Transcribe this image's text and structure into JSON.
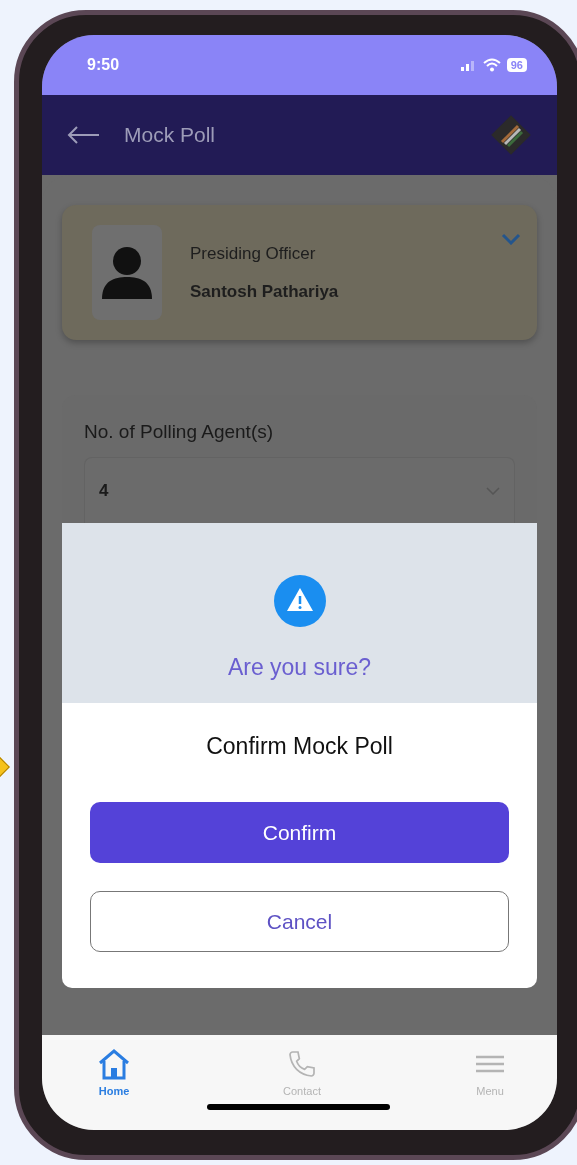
{
  "status_bar": {
    "time": "9:50",
    "battery": "96"
  },
  "header": {
    "title": "Mock Poll"
  },
  "officer_card": {
    "role": "Presiding Officer",
    "name": "Santosh Pathariya"
  },
  "agents_field": {
    "label": "No. of Polling Agent(s)",
    "value": "4"
  },
  "dialog": {
    "title": "Are you sure?",
    "message": "Confirm Mock Poll",
    "buttons": [
      {
        "label": "Confirm",
        "kind": "primary"
      },
      {
        "label": "Cancel",
        "kind": "secondary"
      }
    ]
  },
  "bottom_nav": [
    {
      "label": "Home",
      "kind": "home",
      "selected": true
    },
    {
      "label": "Contact",
      "kind": "phone",
      "selected": false
    },
    {
      "label": "Menu",
      "kind": "menu",
      "selected": false
    }
  ]
}
